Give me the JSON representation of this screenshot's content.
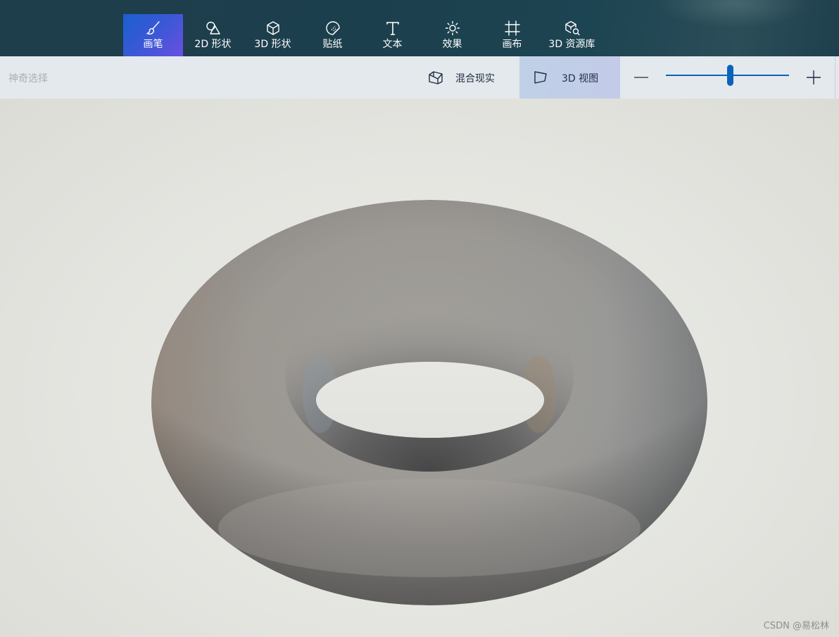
{
  "toolbar": {
    "tools": [
      {
        "label": "画笔",
        "icon": "brush-icon",
        "active": true
      },
      {
        "label": "2D 形状",
        "icon": "2d-shapes-icon"
      },
      {
        "label": "3D 形状",
        "icon": "3d-shapes-icon"
      },
      {
        "label": "贴纸",
        "icon": "sticker-icon"
      },
      {
        "label": "文本",
        "icon": "text-icon"
      },
      {
        "label": "效果",
        "icon": "effects-icon"
      },
      {
        "label": "画布",
        "icon": "canvas-icon"
      },
      {
        "label": "3D 资源库",
        "icon": "3d-library-icon"
      }
    ],
    "active_color": "#3b58d6"
  },
  "subbar": {
    "magic_select": "神奇选择",
    "mixed_reality": "混合现实",
    "view_3d": "3D 视图",
    "zoom_level": 0.52
  },
  "canvas": {
    "object": "torus",
    "watermark": "CSDN @易松林"
  },
  "colors": {
    "ribbon": "#1f3e4c",
    "accent": "#0a63b8",
    "canvas_bg": "#e3e4df"
  }
}
